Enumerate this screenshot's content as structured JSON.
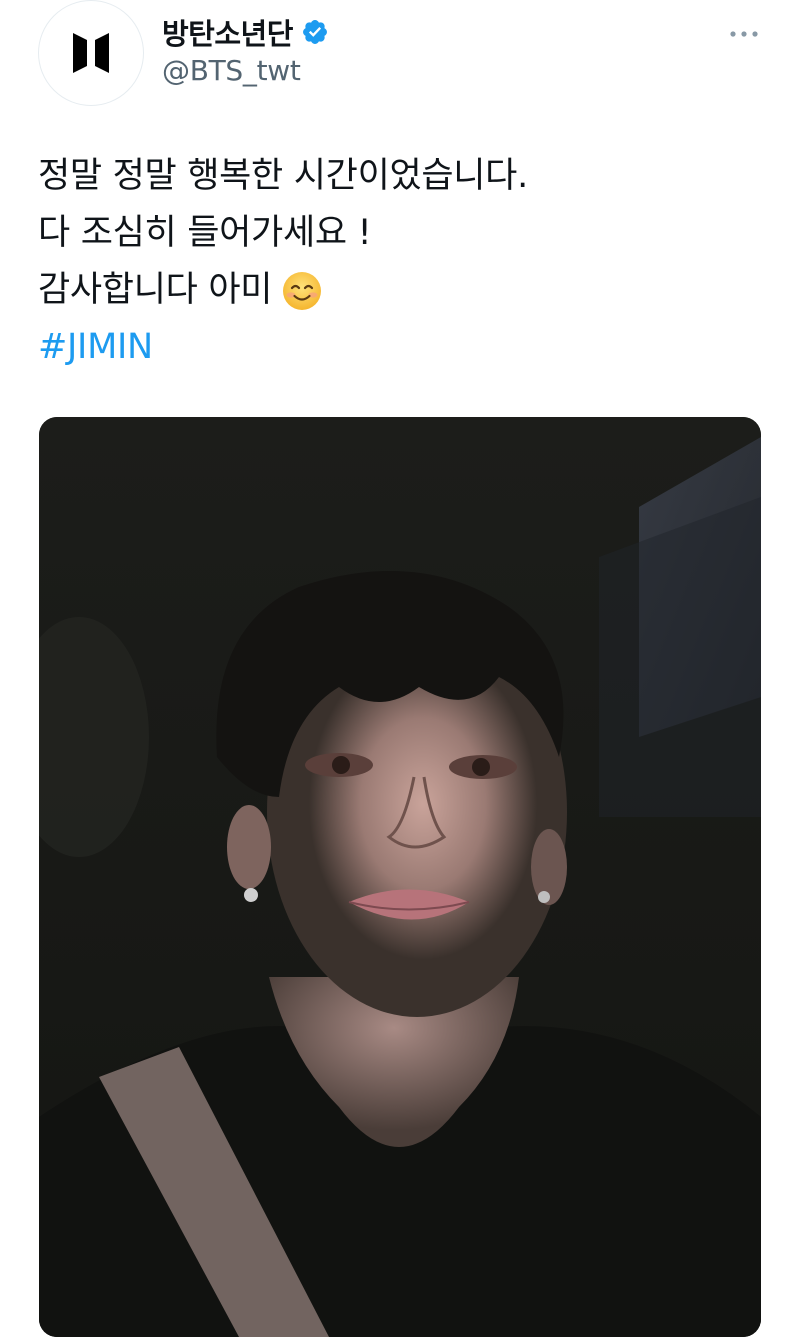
{
  "author": {
    "display_name": "방탄소년단",
    "handle": "@BTS_twt",
    "verified": true,
    "avatar_icon": "bts-logo-icon"
  },
  "more_icon": "more-dots-icon",
  "tweet": {
    "lines": [
      "정말 정말 행복한 시간이었습니다.",
      "다 조심히 들어가세요 !",
      "감사합니다 아미"
    ],
    "emoji": "smiling-face-emoji",
    "hashtag": "#JIMIN"
  },
  "colors": {
    "link": "#1d9bf0",
    "verified_badge": "#1d9bf0",
    "handle_gray": "#536471",
    "text": "#0f1419"
  },
  "media": {
    "type": "photo",
    "description_icon": "photo-image"
  }
}
